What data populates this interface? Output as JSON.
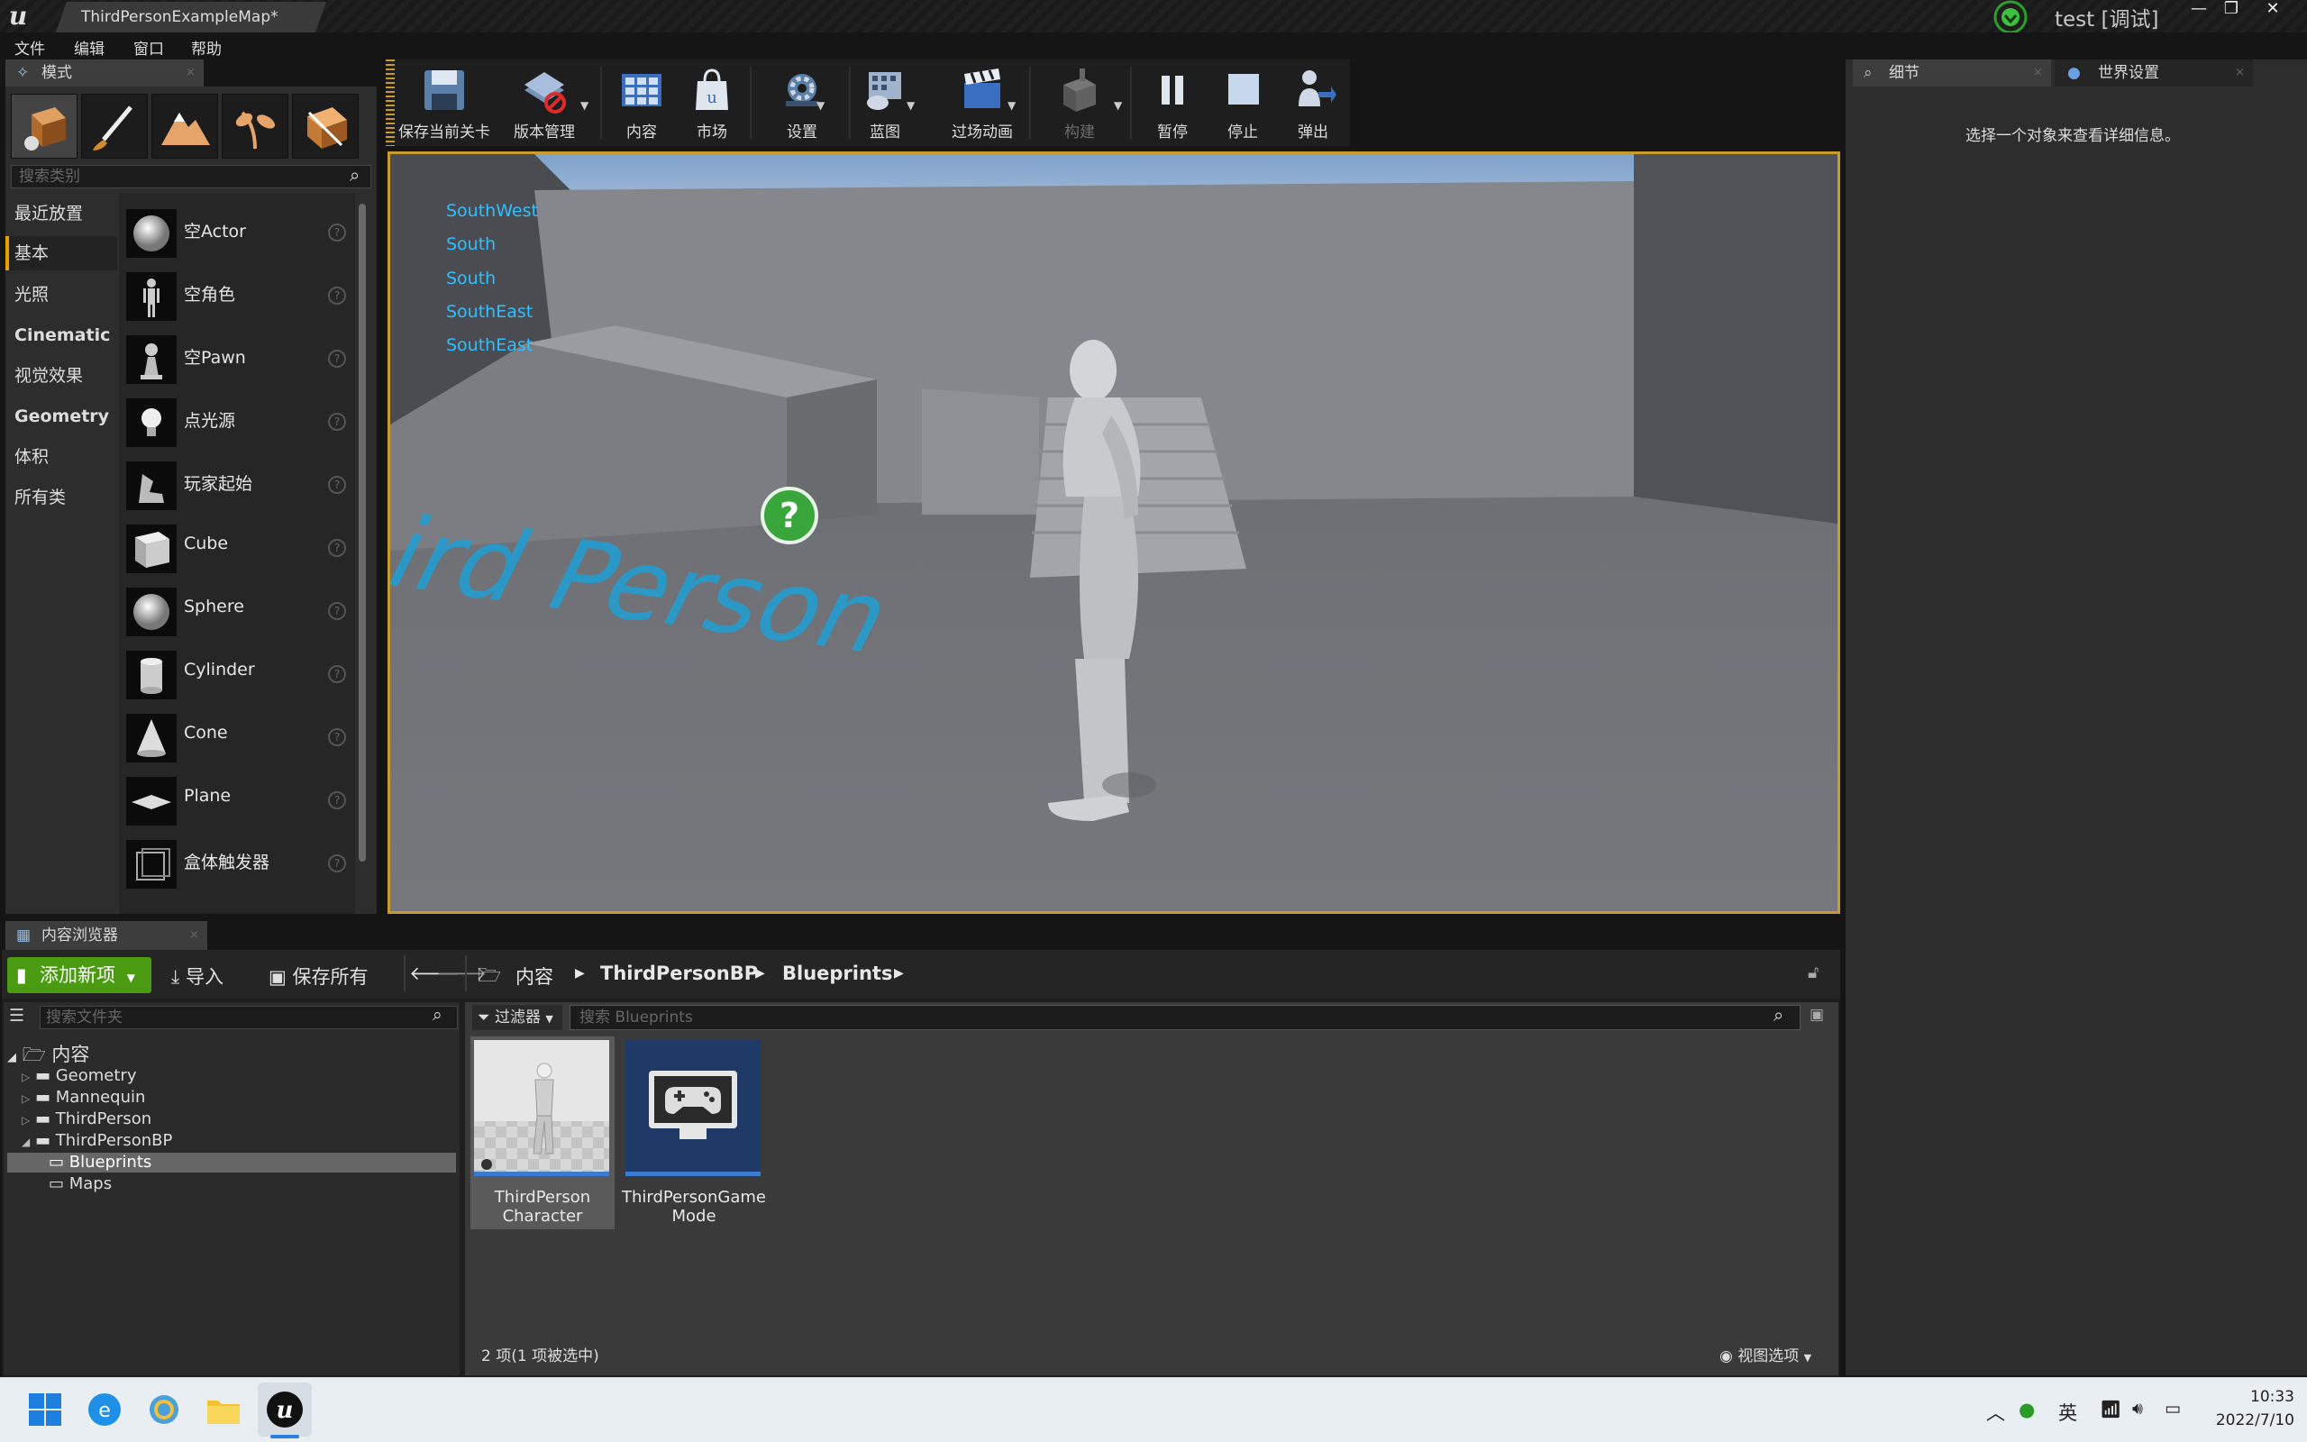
{
  "window": {
    "map_tab": "ThirdPersonExampleMap*",
    "session": "test [调试]"
  },
  "menu": [
    "文件",
    "编辑",
    "窗口",
    "帮助"
  ],
  "modes": {
    "tab_label": "模式",
    "search_placeholder": "搜索类别",
    "categories": [
      "最近放置",
      "基本",
      "光照",
      "Cinematic",
      "视觉效果",
      "Geometry",
      "体积",
      "所有类"
    ],
    "active_category": "基本",
    "items": [
      "空Actor",
      "空角色",
      "空Pawn",
      "点光源",
      "玩家起始",
      "Cube",
      "Sphere",
      "Cylinder",
      "Cone",
      "Plane",
      "盒体触发器"
    ]
  },
  "toolbar": {
    "save": "保存当前关卡",
    "source_control": "版本管理",
    "content": "内容",
    "market": "市场",
    "settings": "设置",
    "blueprints": "蓝图",
    "cinematics": "过场动画",
    "build": "构建",
    "pause": "暂停",
    "stop": "停止",
    "eject": "弹出"
  },
  "viewport": {
    "stats": [
      "SouthWest",
      "South",
      "South",
      "SouthEast",
      "SouthEast"
    ],
    "floor_text": "Third Person"
  },
  "details": {
    "tab_label": "细节",
    "world_tab_label": "世界设置",
    "hint": "选择一个对象来查看详细信息。"
  },
  "content_browser": {
    "tab_label": "内容浏览器",
    "add_new": "添加新项",
    "import": "导入",
    "save_all": "保存所有",
    "breadcrumb": [
      "内容",
      "ThirdPersonBP",
      "Blueprints"
    ],
    "folder_search_placeholder": "搜索文件夹",
    "filter_label": "过滤器",
    "asset_search_placeholder": "搜索 Blueprints",
    "tree": {
      "root": "内容",
      "items": [
        "Geometry",
        "Mannequin",
        "ThirdPerson",
        "ThirdPersonBP",
        "Blueprints",
        "Maps"
      ],
      "selected": "Blueprints"
    },
    "assets": [
      {
        "name_line1": "ThirdPerson",
        "name_line2": "Character"
      },
      {
        "name_line1": "ThirdPersonGame",
        "name_line2": "Mode"
      }
    ],
    "item_count": "2 项(1 项被选中)",
    "view_options": "视图选项"
  },
  "taskbar": {
    "ime": "英",
    "time": "10:33",
    "date": "2022/7/10"
  },
  "colors": {
    "accent_orange": "#c99a2c",
    "add_new_green": "#4a9a12",
    "stat_cyan": "#2ec0ff"
  }
}
